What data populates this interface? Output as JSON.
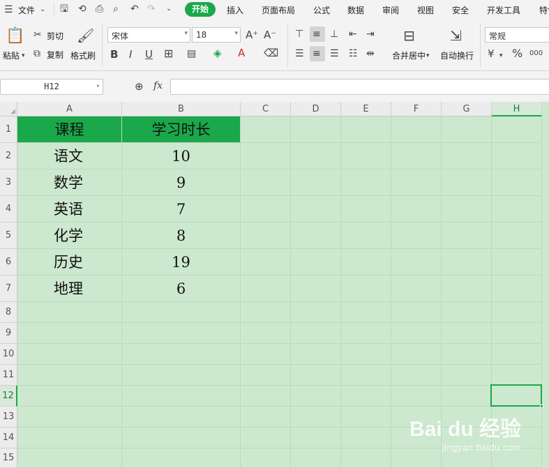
{
  "menu": {
    "file": "文件",
    "tabs": [
      "开始",
      "插入",
      "页面布局",
      "公式",
      "数据",
      "审阅",
      "视图",
      "安全",
      "开发工具",
      "特色"
    ]
  },
  "ribbon": {
    "paste": "粘贴",
    "cut": "剪切",
    "copy": "复制",
    "format_painter": "格式刷",
    "font_name": "宋体",
    "font_size": "18",
    "merge_center": "合并居中",
    "wrap_text": "自动换行",
    "number_format": "常规",
    "bold": "B",
    "italic": "I",
    "underline": "U",
    "percent": "%",
    "thousands": "000"
  },
  "formula_bar": {
    "name_box": "H12",
    "fx": "fx",
    "content": ""
  },
  "sheet": {
    "columns": [
      "A",
      "B",
      "C",
      "D",
      "E",
      "F",
      "G",
      "H"
    ],
    "rows": [
      "1",
      "2",
      "3",
      "4",
      "5",
      "6",
      "7",
      "8",
      "9",
      "10",
      "11",
      "12",
      "13",
      "14",
      "15"
    ],
    "header": [
      "课程",
      "学习时长"
    ],
    "data": [
      [
        "语文",
        "10"
      ],
      [
        "数学",
        "9"
      ],
      [
        "英语",
        "7"
      ],
      [
        "化学",
        "8"
      ],
      [
        "历史",
        "19"
      ],
      [
        "地理",
        "6"
      ]
    ],
    "selected_cell": "H12",
    "header_fill": "#1aa84a",
    "sheet_fill": "#cce8cf"
  },
  "watermark": {
    "brand": "Bai du 经验",
    "url": "jingyan.baidu.com"
  }
}
